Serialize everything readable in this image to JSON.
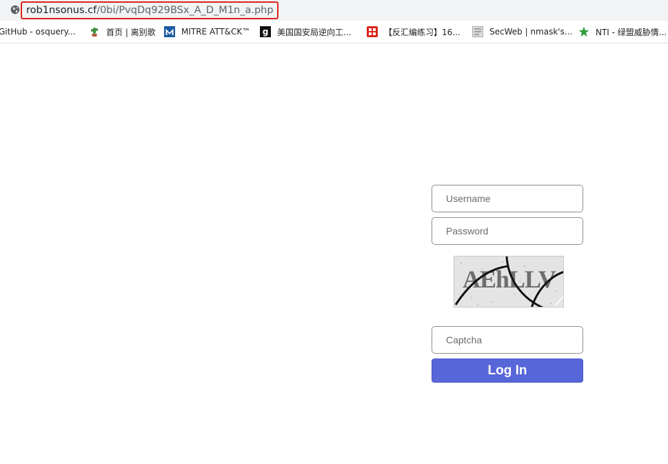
{
  "browser": {
    "url_host": "rob1nsonus.cf",
    "url_path": "/0bi/PvqDq929BSx_A_D_M1n_a.php"
  },
  "bookmarks": [
    {
      "label": "GitHub - osquery...",
      "icon": "github-icon"
    },
    {
      "label": "首页 | 离别歌",
      "icon": "cactus-icon"
    },
    {
      "label": "MITRE ATT&CK™",
      "icon": "mitre-icon"
    },
    {
      "label": "美国国安局逆向工...",
      "icon": "g-icon"
    },
    {
      "label": "【反汇编练习】16...",
      "icon": "red-seal-icon"
    },
    {
      "label": "SecWeb | nmask's...",
      "icon": "secweb-icon"
    },
    {
      "label": "NTI - 绿盟威胁情...",
      "icon": "star-icon"
    }
  ],
  "login": {
    "username_placeholder": "Username",
    "password_placeholder": "Password",
    "captcha_text": "AEhLLV",
    "captcha_placeholder": "Captcha",
    "submit_label": "Log In"
  },
  "colors": {
    "url_highlight": "#e0201b",
    "button": "#5766d8"
  }
}
